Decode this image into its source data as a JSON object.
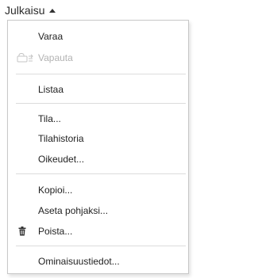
{
  "menubar": {
    "label": "Julkaisu",
    "caret_icon": "caret-up-icon"
  },
  "menu": {
    "items": [
      {
        "label": "Varaa",
        "enabled": true,
        "icon": null
      },
      {
        "label": "Vapauta",
        "enabled": false,
        "icon": "release-lock-icon"
      },
      {
        "label": "Listaa",
        "enabled": true,
        "icon": null
      },
      {
        "label": "Tila...",
        "enabled": true,
        "icon": null
      },
      {
        "label": "Tilahistoria",
        "enabled": true,
        "icon": null
      },
      {
        "label": "Oikeudet...",
        "enabled": true,
        "icon": null
      },
      {
        "label": "Kopioi...",
        "enabled": true,
        "icon": null
      },
      {
        "label": "Aseta pohjaksi...",
        "enabled": true,
        "icon": null
      },
      {
        "label": "Poista...",
        "enabled": true,
        "icon": "trash-icon"
      },
      {
        "label": "Ominaisuustiedot...",
        "enabled": true,
        "icon": null
      }
    ]
  },
  "colors": {
    "text": "#1f1f1f",
    "disabled_text": "#b3b3b3",
    "border": "#c8c8c8",
    "divider": "#dcdcdc"
  }
}
